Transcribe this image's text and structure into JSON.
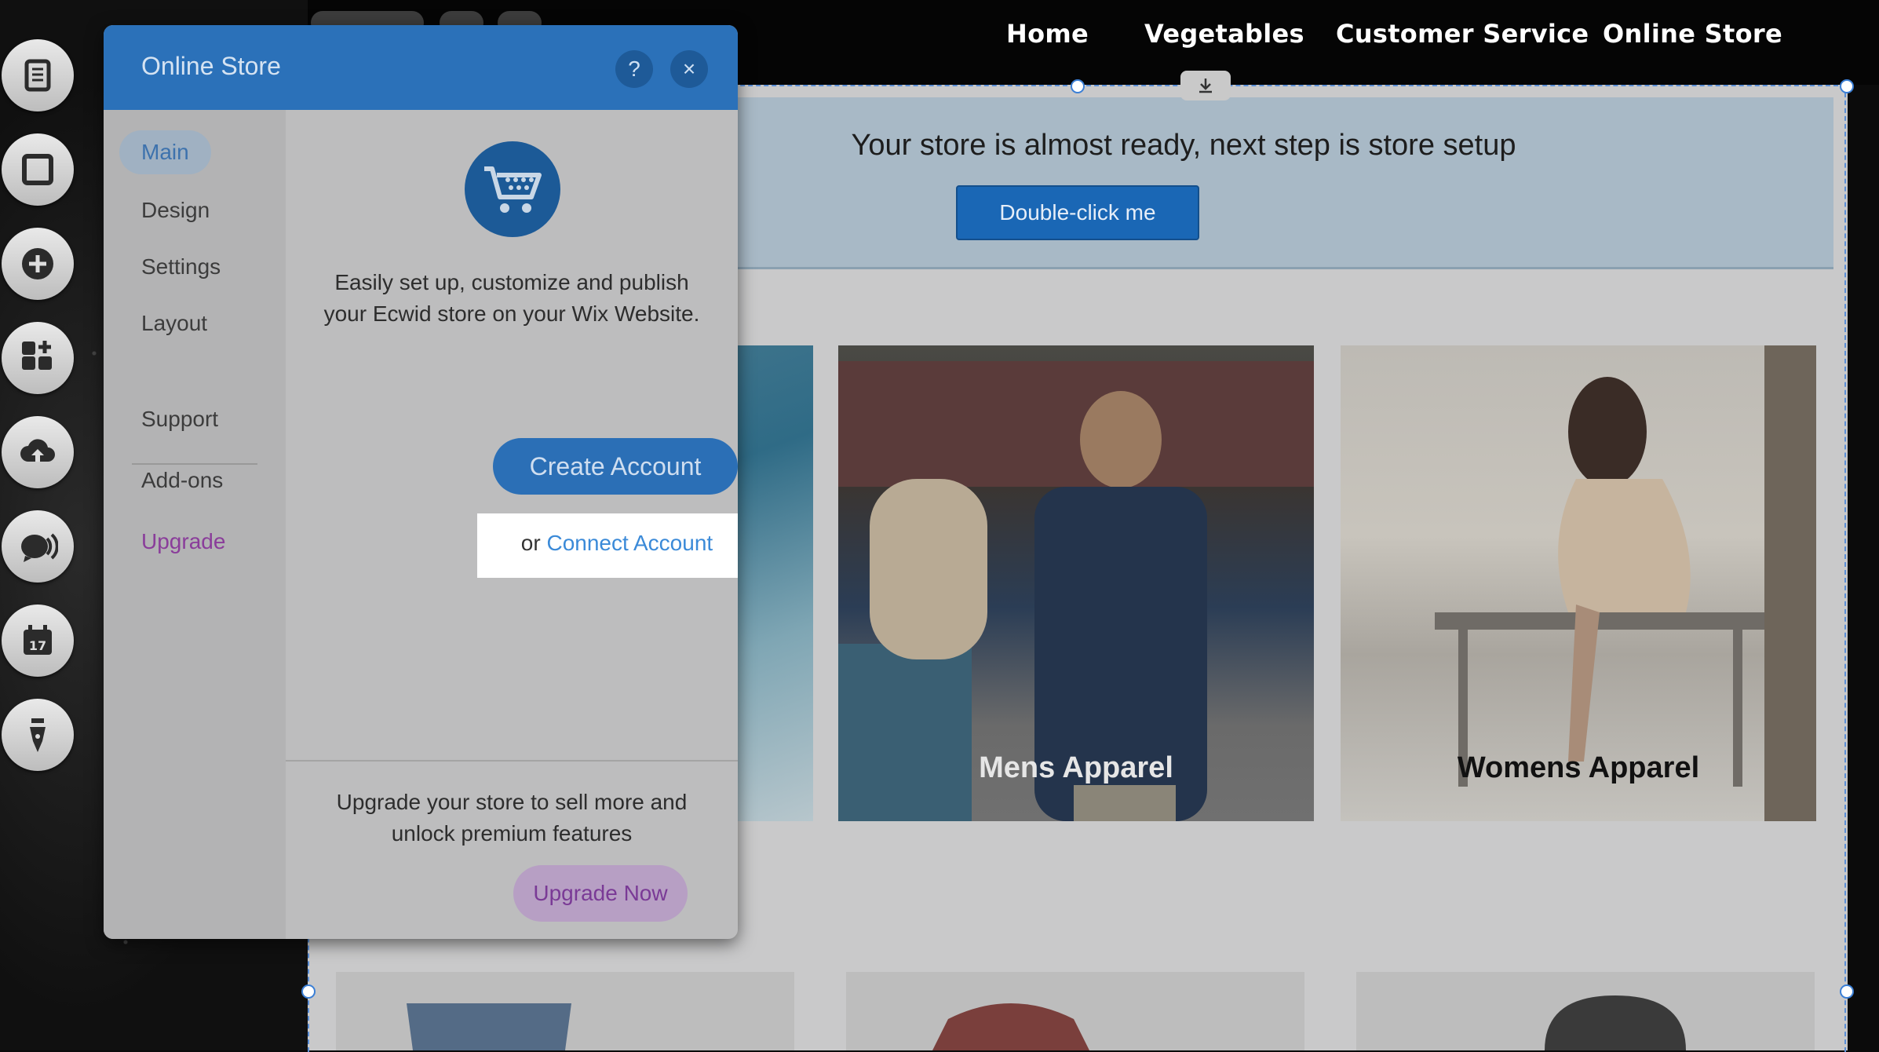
{
  "top_nav": {
    "items": [
      "Home",
      "Vegetables",
      "Customer Service",
      "Online Store"
    ]
  },
  "left_rail": {
    "icons": [
      "pages-icon",
      "background-icon",
      "add-icon",
      "apps-icon",
      "upload-icon",
      "blog-icon",
      "bookings-icon",
      "pen-icon"
    ]
  },
  "banner": {
    "text": "Your store is almost ready, next step is store setup",
    "button": "Double-click me"
  },
  "categories": [
    {
      "label": ""
    },
    {
      "label": "Mens Apparel"
    },
    {
      "label": "Womens Apparel"
    }
  ],
  "dialog": {
    "title": "Online Store",
    "help": "?",
    "close": "×",
    "sidebar": {
      "items": [
        "Main",
        "Design",
        "Settings",
        "Layout"
      ],
      "secondary": [
        "Support",
        "Add-ons"
      ],
      "upgrade": "Upgrade",
      "active": "Main"
    },
    "main": {
      "description_line1": "Easily set up, customize and publish",
      "description_line2": "your Ecwid store on your Wix Website.",
      "create_button": "Create Account",
      "connect_prefix": "or",
      "connect_link": "Connect Account",
      "footer_line1": "Upgrade your store to sell more and",
      "footer_line2": "unlock premium features",
      "upgrade_button": "Upgrade Now"
    }
  },
  "colors": {
    "dialog_header": "#2b71b9",
    "upgrade_purple": "#8a3d9a",
    "link_blue": "#3b8ad8"
  }
}
